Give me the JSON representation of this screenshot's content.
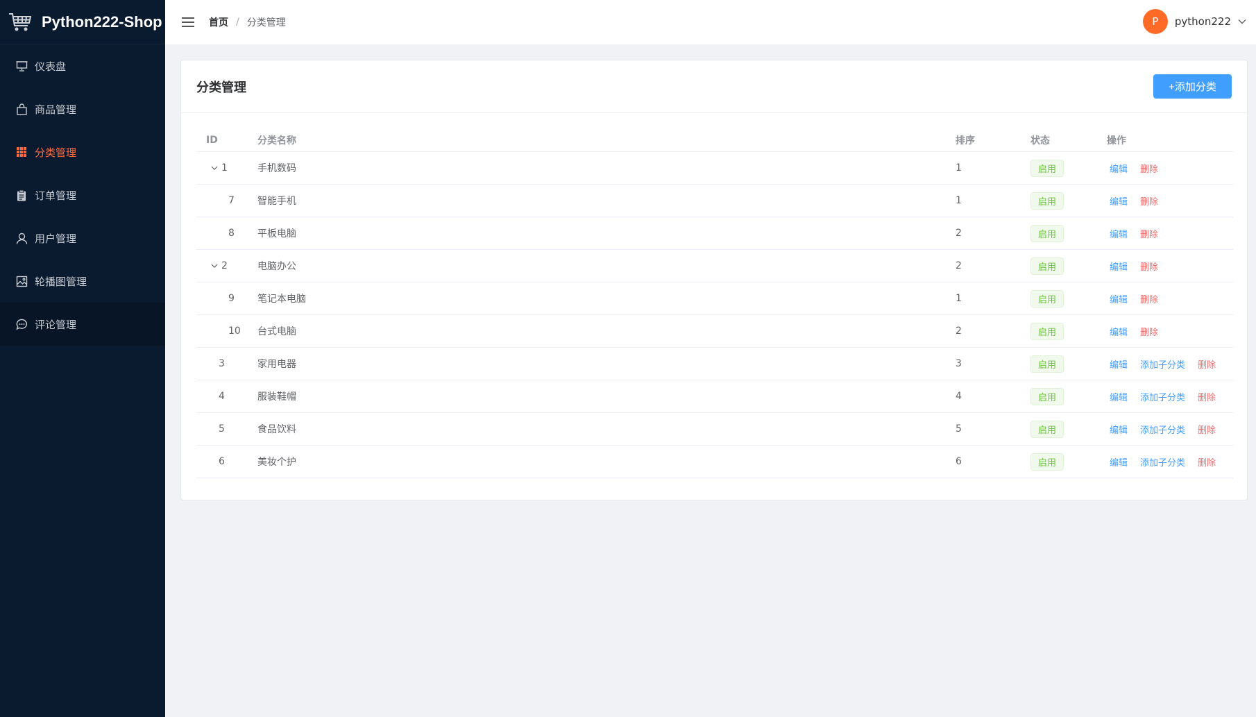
{
  "app": {
    "title": "Python222-Shop"
  },
  "sidebar": {
    "items": [
      {
        "label": "仪表盘",
        "icon": "dashboard-icon"
      },
      {
        "label": "商品管理",
        "icon": "shopping-bag-icon"
      },
      {
        "label": "分类管理",
        "icon": "grid-icon",
        "active": true
      },
      {
        "label": "订单管理",
        "icon": "clipboard-icon"
      },
      {
        "label": "用户管理",
        "icon": "user-icon"
      },
      {
        "label": "轮播图管理",
        "icon": "image-icon"
      },
      {
        "label": "评论管理",
        "icon": "chat-icon",
        "hovered": true
      }
    ]
  },
  "header": {
    "breadcrumb_home": "首页",
    "breadcrumb_sep": "/",
    "breadcrumb_current": "分类管理",
    "avatar_letter": "P",
    "username": "python222"
  },
  "card": {
    "title": "分类管理",
    "add_button": "+添加分类"
  },
  "table": {
    "columns": [
      "ID",
      "分类名称",
      "排序",
      "状态",
      "操作"
    ],
    "rows": [
      {
        "id": "1",
        "name": "手机数码",
        "sort": "1",
        "status": "启用",
        "ops": [
          "编辑",
          "删除"
        ],
        "level": 0,
        "expandable": true
      },
      {
        "id": "7",
        "name": "智能手机",
        "sort": "1",
        "status": "启用",
        "ops": [
          "编辑",
          "删除"
        ],
        "level": 1
      },
      {
        "id": "8",
        "name": "平板电脑",
        "sort": "2",
        "status": "启用",
        "ops": [
          "编辑",
          "删除"
        ],
        "level": 1
      },
      {
        "id": "2",
        "name": "电脑办公",
        "sort": "2",
        "status": "启用",
        "ops": [
          "编辑",
          "删除"
        ],
        "level": 0,
        "expandable": true
      },
      {
        "id": "9",
        "name": "笔记本电脑",
        "sort": "1",
        "status": "启用",
        "ops": [
          "编辑",
          "删除"
        ],
        "level": 1
      },
      {
        "id": "10",
        "name": "台式电脑",
        "sort": "2",
        "status": "启用",
        "ops": [
          "编辑",
          "删除"
        ],
        "level": 1
      },
      {
        "id": "3",
        "name": "家用电器",
        "sort": "3",
        "status": "启用",
        "ops": [
          "编辑",
          "添加子分类",
          "删除"
        ],
        "level": 0
      },
      {
        "id": "4",
        "name": "服装鞋帽",
        "sort": "4",
        "status": "启用",
        "ops": [
          "编辑",
          "添加子分类",
          "删除"
        ],
        "level": 0
      },
      {
        "id": "5",
        "name": "食品饮料",
        "sort": "5",
        "status": "启用",
        "ops": [
          "编辑",
          "添加子分类",
          "删除"
        ],
        "level": 0
      },
      {
        "id": "6",
        "name": "美妆个护",
        "sort": "6",
        "status": "启用",
        "ops": [
          "编辑",
          "添加子分类",
          "删除"
        ],
        "level": 0
      }
    ]
  },
  "colors": {
    "sidebar_bg": "#0a1a2f",
    "active": "#ff6a3d",
    "primary": "#409eff",
    "danger": "#f56c6c",
    "success": "#67c23a"
  }
}
